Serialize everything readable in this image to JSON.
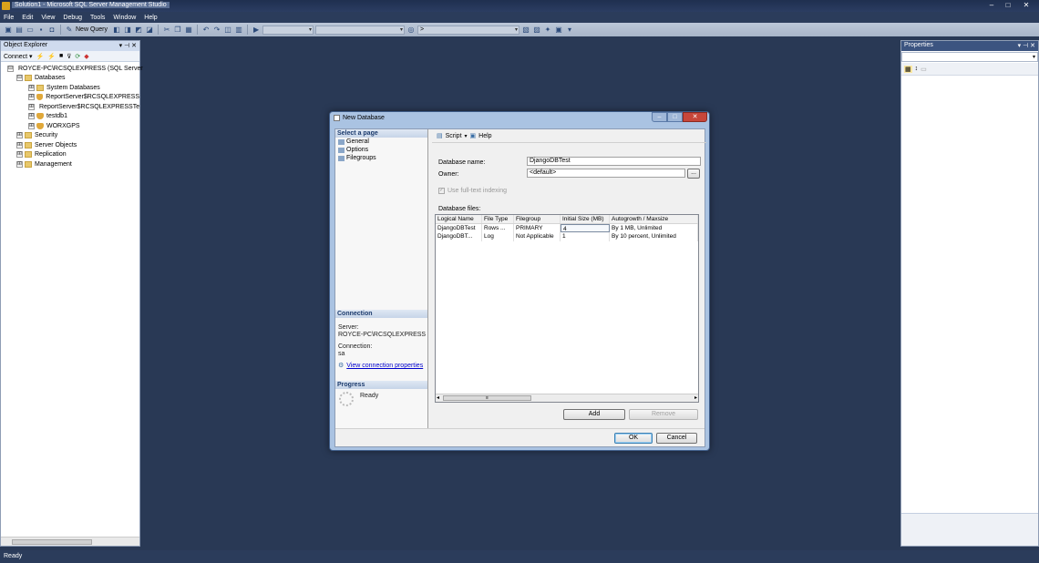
{
  "window": {
    "title": "Solution1 - Microsoft SQL Server Management Studio",
    "min_glyph": "–",
    "max_glyph": "□",
    "close_glyph": "✕"
  },
  "menu": [
    "File",
    "Edit",
    "View",
    "Debug",
    "Tools",
    "Window",
    "Help"
  ],
  "toolbar": {
    "new_query_label": "New Query",
    "db_combo_value": ">"
  },
  "object_explorer": {
    "title": "Object Explorer",
    "pin": "▾ ⊣ ✕",
    "connect_label": "Connect ▾",
    "nodes": [
      {
        "label": "ROYCE-PC\\RCSQLEXPRESS (SQL Server",
        "expander": "⊟",
        "icon": "server-icon"
      },
      {
        "label": "Databases",
        "expander": "⊟",
        "icon": "folder-icon"
      },
      {
        "label": "System Databases",
        "expander": "⊞",
        "icon": "folder-icon"
      },
      {
        "label": "ReportServer$RCSQLEXPRESS",
        "expander": "⊞",
        "icon": "database-icon"
      },
      {
        "label": "ReportServer$RCSQLEXPRESSTe",
        "expander": "⊞",
        "icon": "database-icon"
      },
      {
        "label": "testdb1",
        "expander": "⊞",
        "icon": "database-icon"
      },
      {
        "label": "WORXGPS",
        "expander": "⊞",
        "icon": "database-icon"
      },
      {
        "label": "Security",
        "expander": "⊞",
        "icon": "folder-icon"
      },
      {
        "label": "Server Objects",
        "expander": "⊞",
        "icon": "folder-icon"
      },
      {
        "label": "Replication",
        "expander": "⊞",
        "icon": "folder-icon"
      },
      {
        "label": "Management",
        "expander": "⊞",
        "icon": "folder-icon"
      }
    ]
  },
  "properties": {
    "title": "Properties",
    "pin": "▾ ⊣ ✕"
  },
  "status": {
    "text": "Ready"
  },
  "dialog": {
    "title": "New Database",
    "left": {
      "select_page_header": "Select a page",
      "pages": [
        "General",
        "Options",
        "Filegroups"
      ],
      "connection_header": "Connection",
      "server_label": "Server:",
      "server_value": "ROYCE-PC\\RCSQLEXPRESS",
      "connection_label": "Connection:",
      "connection_value": "sa",
      "view_link": "View connection properties",
      "progress_header": "Progress",
      "progress_status": "Ready"
    },
    "toolbar": {
      "script_label": "Script",
      "help_label": "Help"
    },
    "form": {
      "db_name_label": "Database name:",
      "db_name_value": "DjangoDBTest",
      "owner_label": "Owner:",
      "owner_value": "<default>",
      "browse_label": "...",
      "fulltext_label": "Use full-text indexing",
      "fulltext_checked": true,
      "files_label": "Database files:"
    },
    "grid": {
      "columns": [
        "Logical Name",
        "File Type",
        "Filegroup",
        "Initial Size (MB)",
        "Autogrowth / Maxsize"
      ],
      "rows": [
        [
          "DjangoDBTest",
          "Rows ...",
          "PRIMARY",
          "4",
          "By 1 MB, Unlimited"
        ],
        [
          "DjangoDBT...",
          "Log",
          "Not Applicable",
          "1",
          "By 10 percent, Unlimited"
        ]
      ]
    },
    "buttons": {
      "add": "Add",
      "remove": "Remove",
      "ok": "OK",
      "cancel": "Cancel"
    }
  }
}
